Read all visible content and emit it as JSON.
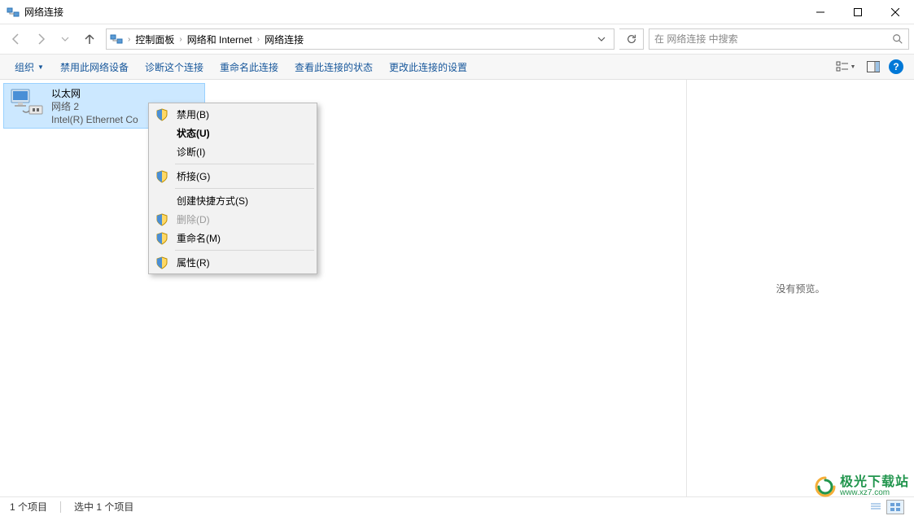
{
  "titlebar": {
    "title": "网络连接"
  },
  "breadcrumbs": {
    "b1": "控制面板",
    "b2": "网络和 Internet",
    "b3": "网络连接"
  },
  "search": {
    "placeholder": "在 网络连接 中搜索"
  },
  "toolbar": {
    "organize": "组织",
    "disable": "禁用此网络设备",
    "diagnose": "诊断这个连接",
    "rename": "重命名此连接",
    "status": "查看此连接的状态",
    "settings": "更改此连接的设置"
  },
  "adapter": {
    "name": "以太网",
    "status": "网络 2",
    "device": "Intel(R) Ethernet Co"
  },
  "context_menu": {
    "disable": "禁用(B)",
    "status": "状态(U)",
    "diagnose": "诊断(I)",
    "bridge": "桥接(G)",
    "shortcut": "创建快捷方式(S)",
    "delete": "删除(D)",
    "rename": "重命名(M)",
    "properties": "属性(R)"
  },
  "preview": {
    "none": "没有预览。"
  },
  "statusbar": {
    "count": "1 个项目",
    "selected": "选中 1 个项目"
  },
  "watermark": {
    "name": "极光下载站",
    "url": "www.xz7.com"
  }
}
